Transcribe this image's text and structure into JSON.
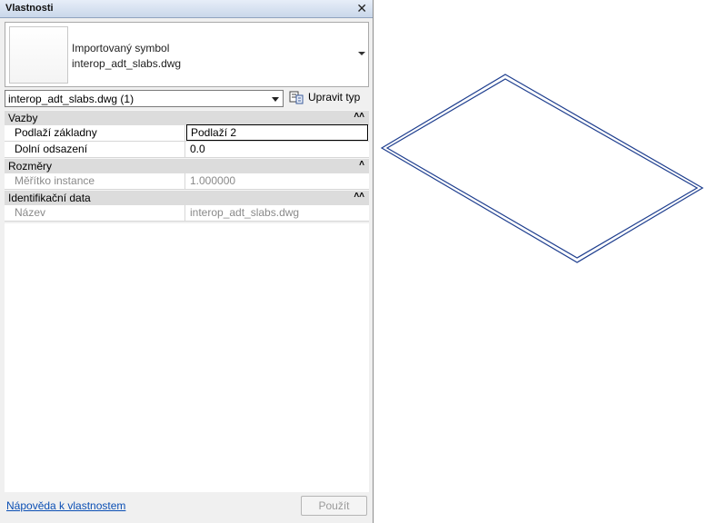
{
  "panel": {
    "title": "Vlastnosti",
    "close_glyph": "✕"
  },
  "type_selector": {
    "category": "Importovaný symbol",
    "type_name": "interop_adt_slabs.dwg"
  },
  "instance_filter": {
    "value": "interop_adt_slabs.dwg (1)"
  },
  "edit_type": {
    "label": "Upravit typ"
  },
  "groups": [
    {
      "label": "Vazby",
      "rows": [
        {
          "name": "Podlaží základny",
          "value": "Podlaží 2"
        },
        {
          "name": "Dolní odsazení",
          "value": "0.0"
        }
      ]
    },
    {
      "label": "Rozměry",
      "rows": [
        {
          "name": "Měřítko instance",
          "value": "1.000000"
        }
      ]
    },
    {
      "label": "Identifikační data",
      "rows": [
        {
          "name": "Název",
          "value": "interop_adt_slabs.dwg"
        }
      ]
    }
  ],
  "footer": {
    "help_link": "Nápověda k vlastnostem",
    "apply_label": "Použít"
  },
  "colors": {
    "slab_outline": "#1f3f8f",
    "link": "#0b4fb4"
  }
}
